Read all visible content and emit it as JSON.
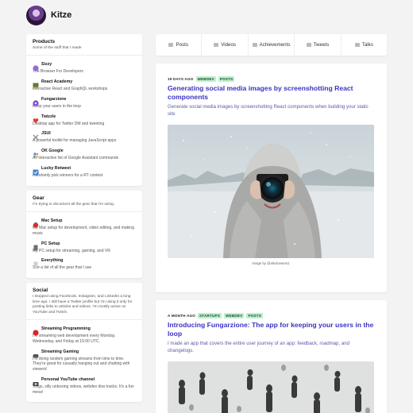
{
  "site": {
    "title": "Kitze"
  },
  "tabs": [
    {
      "label": "Posts",
      "icon": "document-icon"
    },
    {
      "label": "Videos",
      "icon": "video-icon"
    },
    {
      "label": "Achievements",
      "icon": "trophy-icon"
    },
    {
      "label": "Tweets",
      "icon": "bird-icon"
    },
    {
      "label": "Talks",
      "icon": "microphone-icon"
    }
  ],
  "products": {
    "title": "Products",
    "subtitle": "Some of the stuff that I made",
    "items": [
      {
        "name": "Sizzy",
        "desc": "The Browser For Developers",
        "icon": "sizzy-icon",
        "color": "#9b6ad0"
      },
      {
        "name": "React Academy",
        "desc": "Interactive React and GraphQL workshops",
        "icon": "classroom-icon",
        "color": "#8a9a5b"
      },
      {
        "name": "Fungarzione",
        "desc": "Keep your users in the loop",
        "icon": "fungarzione-icon",
        "color": "#7b4bd6"
      },
      {
        "name": "Twizzle",
        "desc": "Desktop app for Twitter DM and tweeting",
        "icon": "heart-icon",
        "color": "#e53935"
      },
      {
        "name": "JSUI",
        "desc": "A powerful toolkit for managing JavaScript apps",
        "icon": "tools-icon",
        "color": "#8d8d8d"
      },
      {
        "name": "OK Google",
        "desc": "An interactive list of Google Assistant commands",
        "icon": "google-assistant-icon",
        "color": "#4f7be8"
      },
      {
        "name": "Lucky Retweet",
        "desc": "Randomly pick winners for a RT contest",
        "icon": "checkbox-icon",
        "color": "#3b82d8"
      }
    ]
  },
  "gear": {
    "title": "Gear",
    "subtitle": "I'm trying to document all the gear that I'm using.",
    "items": [
      {
        "name": "Mac Setup",
        "desc": "My Mac setup for development, video editing, and making music",
        "icon": "apple-icon",
        "color": "#d32f2f"
      },
      {
        "name": "PC Setup",
        "desc": "My PC setup for streaming, gaming, and VR",
        "icon": "pc-icon",
        "color": "#6e6e6e"
      },
      {
        "name": "Everything",
        "desc": "See a list of all the gear that I use",
        "icon": "page-icon",
        "color": "#cfcfcf"
      }
    ]
  },
  "social": {
    "title": "Social",
    "subtitle": "I stopped using Facebook, Instagram, and LinkedIn a long time ago. I still have a Twitter profile but I'm using it only for posting links to articles and videos. I'm mostly active on YouTube and Twitch.",
    "items": [
      {
        "name": "Streaming Programming",
        "desc": "I'm streaming web development every Monday, Wednesday, and Friday at 15:00 UTC.",
        "icon": "red-circle-icon",
        "color": "#d8262c"
      },
      {
        "name": "Streaming Gaming",
        "desc": "I'm doing random gaming streams from time to time. They're great for casually hanging out and chatting with viewers!",
        "icon": "gamepad-icon",
        "color": "#555555"
      },
      {
        "name": "Personal YouTube channel",
        "desc": "Vlogs, silly unboxing videos, webdev diss tracks. It's a fun mess!",
        "icon": "camera-icon",
        "color": "#444444"
      }
    ]
  },
  "posts": [
    {
      "date": "19 DAYS AGO",
      "tags": [
        "WEBDEV",
        "POSTS"
      ],
      "title": "Generating social media images by screenshotting React components",
      "desc": "Generate social media images by screenshotting React components when building your static site",
      "caption": "Image by @alexbowers1"
    },
    {
      "date": "A MONTH AGO",
      "tags": [
        "STARTUPS",
        "WEBDEV",
        "POSTS"
      ],
      "title": "Introducing Fungarzione: The app for keeping your users in the loop",
      "desc": "I made an app that covers the entire user journey of an app: feedback, roadmap, and changelogs."
    }
  ]
}
